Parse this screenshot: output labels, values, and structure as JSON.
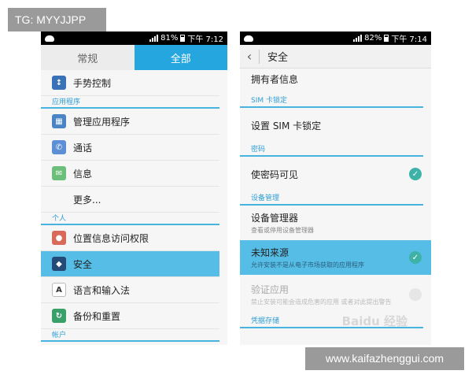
{
  "watermark_top": "TG: MYYJJPP",
  "watermark_bottom": "www.kaifazhenggui.com",
  "left": {
    "status": {
      "battery": "81%",
      "time": "下午 7:12"
    },
    "tabs": [
      "常规",
      "全部"
    ],
    "rows": [
      {
        "type": "item",
        "label": "手势控制",
        "icon": "gesture-icon"
      },
      {
        "type": "header",
        "label": "应用程序"
      },
      {
        "type": "item",
        "label": "管理应用程序",
        "icon": "apps-icon"
      },
      {
        "type": "item",
        "label": "通话",
        "icon": "phone-icon"
      },
      {
        "type": "item",
        "label": "信息",
        "icon": "message-icon"
      },
      {
        "type": "item",
        "label": "更多..."
      },
      {
        "type": "header",
        "label": "个人"
      },
      {
        "type": "item",
        "label": "位置信息访问权限",
        "icon": "location-icon"
      },
      {
        "type": "item",
        "label": "安全",
        "icon": "shield-icon",
        "selected": true
      },
      {
        "type": "item",
        "label": "语言和输入法",
        "icon": "keyboard-icon"
      },
      {
        "type": "item",
        "label": "备份和重置",
        "icon": "backup-icon"
      },
      {
        "type": "header",
        "label": "帐户"
      }
    ]
  },
  "right": {
    "status": {
      "battery": "82%",
      "time": "下午 7:14"
    },
    "title": "安全",
    "owner_info": "拥有者信息",
    "sim_section": "SIM 卡锁定",
    "sim_lock": "设置 SIM 卡锁定",
    "password_section": "密码",
    "password_visible": "使密码可见",
    "device_section": "设备管理",
    "device_admin": "设备管理器",
    "device_admin_sub": "查看或停用设备管理器",
    "unknown_sources": "未知来源",
    "unknown_sources_sub": "允许安装不是从电子市场获取的应用程序",
    "verify_apps": "验证应用",
    "verify_apps_sub": "禁止安装可能会造成危害的应用 或者对此提出警告",
    "storage_section": "凭据存储",
    "baidu_watermark": "Baidu 经验"
  }
}
